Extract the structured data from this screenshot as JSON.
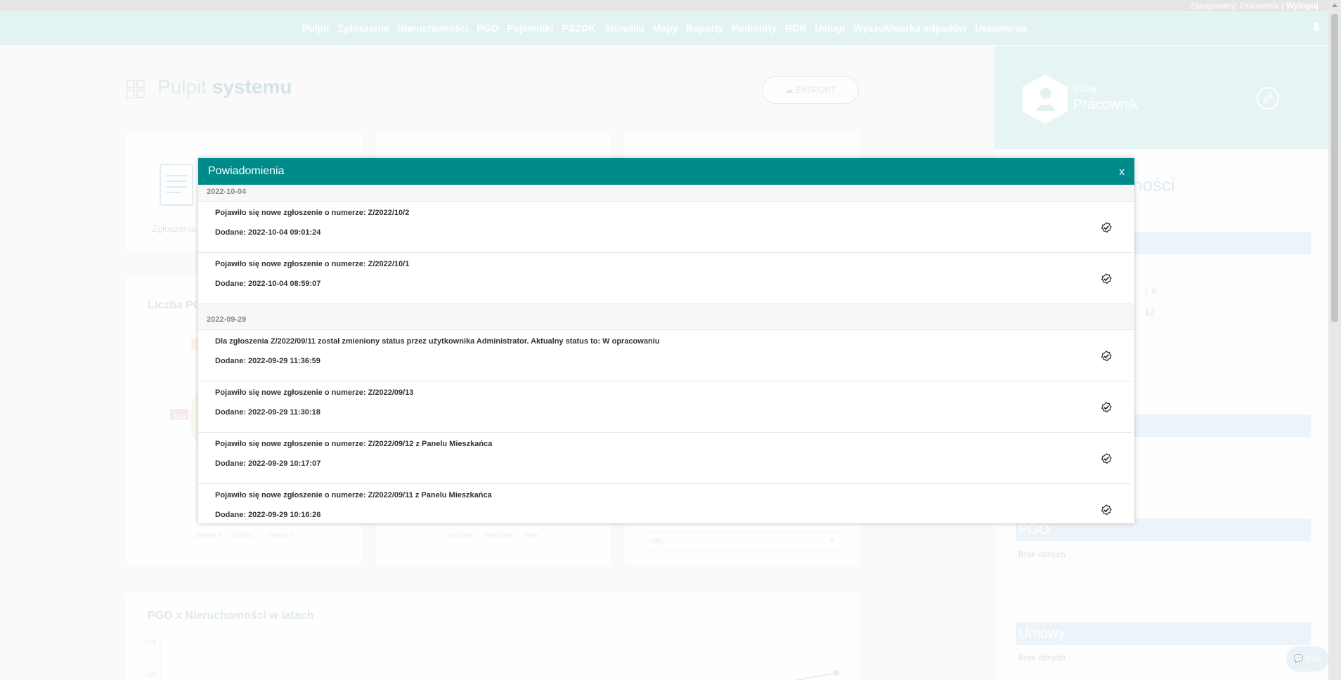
{
  "header": {
    "login_prefix": "Zalogowany: Pracownik |",
    "logout": "Wyloguj"
  },
  "nav": [
    {
      "label": "Pulpit"
    },
    {
      "label": "Zgłoszenia"
    },
    {
      "label": "Nieruchomości"
    },
    {
      "label": "PGO"
    },
    {
      "label": "Pojemniki"
    },
    {
      "label": "PSZOK"
    },
    {
      "label": "Słowniki"
    },
    {
      "label": "Mapy"
    },
    {
      "label": "Raporty"
    },
    {
      "label": "Podmioty"
    },
    {
      "label": "RDR"
    },
    {
      "label": "Usługi"
    },
    {
      "label": "Wyszukiwarka odpadów"
    },
    {
      "label": "Ustawienia"
    }
  ],
  "page": {
    "title_light": "Pulpit",
    "title_bold": "systemu",
    "export_label": "EKSPORT",
    "card1_label": "Zgłoszenia",
    "chart1_title": "Liczba PG",
    "chart_bottom_title": "PGO x Nieruchomości w latach",
    "pie_label_516": "516",
    "legend_a": "Sektor 2",
    "legend_b": "Sektor 1",
    "legend_c": "Sektor 5",
    "legend_d": "niezam",
    "legend_e": "mieszany",
    "legend_f": "zam",
    "select_value": "żółty",
    "axis_500": "500",
    "axis_400": "400"
  },
  "profile": {
    "welcome": "Witaj,",
    "name": "Pracownik",
    "section_partial": "ności",
    "stat1": "j: 0",
    "stat2": "12",
    "pgo_heading": "PGO",
    "pgo_empty": "Brak danych",
    "umowy_heading": "Umowy",
    "umowy_empty": "Brak danych",
    "chat": "Czat"
  },
  "modal": {
    "title": "Powiadomienia",
    "close": "x",
    "groups": [
      {
        "date": "2022-10-04",
        "items": [
          {
            "text": "Pojawiło się nowe zgłoszenie o numerze: Z/2022/10/2",
            "added": "Dodane: 2022-10-04 09:01:24"
          },
          {
            "text": "Pojawiło się nowe zgłoszenie o numerze: Z/2022/10/1",
            "added": "Dodane: 2022-10-04 08:59:07"
          }
        ]
      },
      {
        "date": "2022-09-29",
        "items": [
          {
            "text": "Dla zgłoszenia Z/2022/09/11 został zmieniony status przez użytkownika Administrator. Aktualny status to: W opracowaniu",
            "added": "Dodane: 2022-09-29 11:36:59"
          },
          {
            "text": "Pojawiło się nowe zgłoszenie o numerze: Z/2022/09/13",
            "added": "Dodane: 2022-09-29 11:30:18"
          },
          {
            "text": "Pojawiło się nowe zgłoszenie o numerze: Z/2022/09/12 z Panelu Mieszkańca",
            "added": "Dodane: 2022-09-29 10:17:07"
          },
          {
            "text": "Pojawiło się nowe zgłoszenie o numerze: Z/2022/09/11 z Panelu Mieszkańca",
            "added": "Dodane: 2022-09-29 10:16:26"
          }
        ]
      }
    ]
  }
}
